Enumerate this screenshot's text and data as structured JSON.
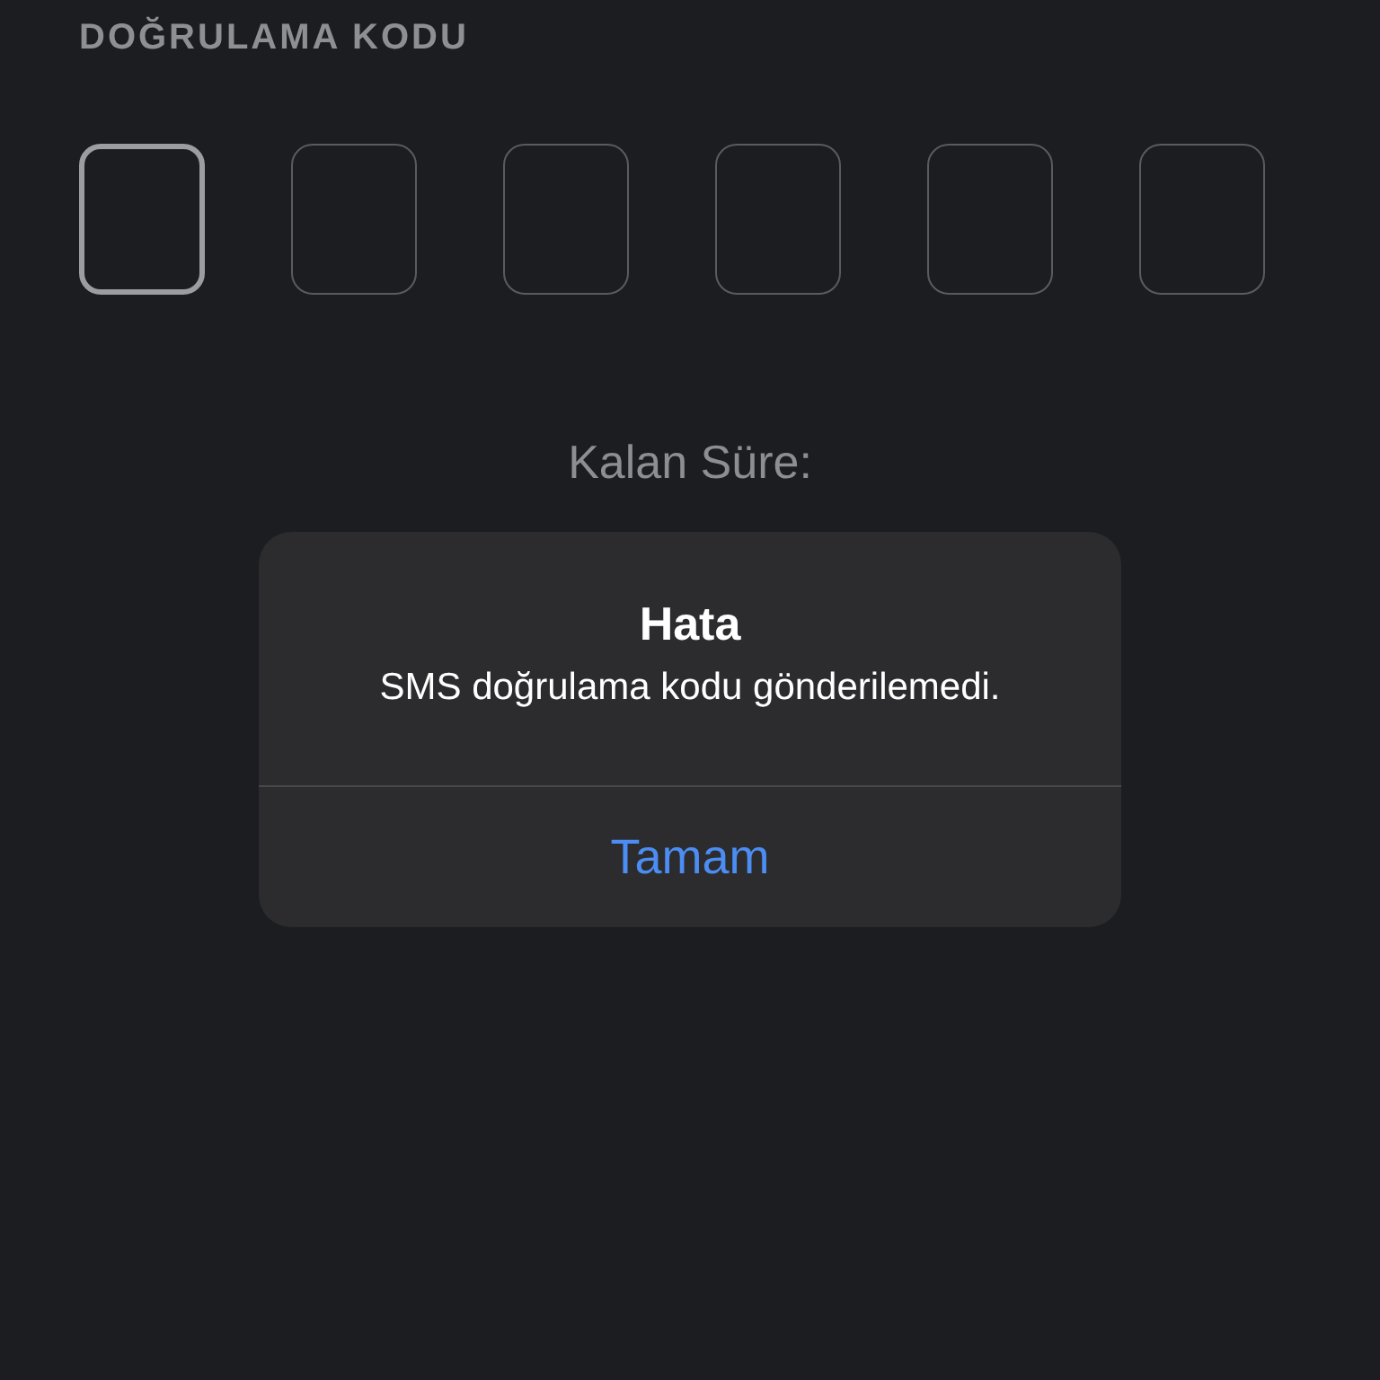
{
  "section_label": "DOĞRULAMA KODU",
  "code_boxes": [
    {
      "focused": true
    },
    {
      "focused": false
    },
    {
      "focused": false
    },
    {
      "focused": false
    },
    {
      "focused": false
    },
    {
      "focused": false
    }
  ],
  "timer_label": "Kalan Süre:",
  "alert": {
    "title": "Hata",
    "message": "SMS doğrulama kodu gönderilemedi.",
    "buttons": [
      "Tamam"
    ]
  }
}
